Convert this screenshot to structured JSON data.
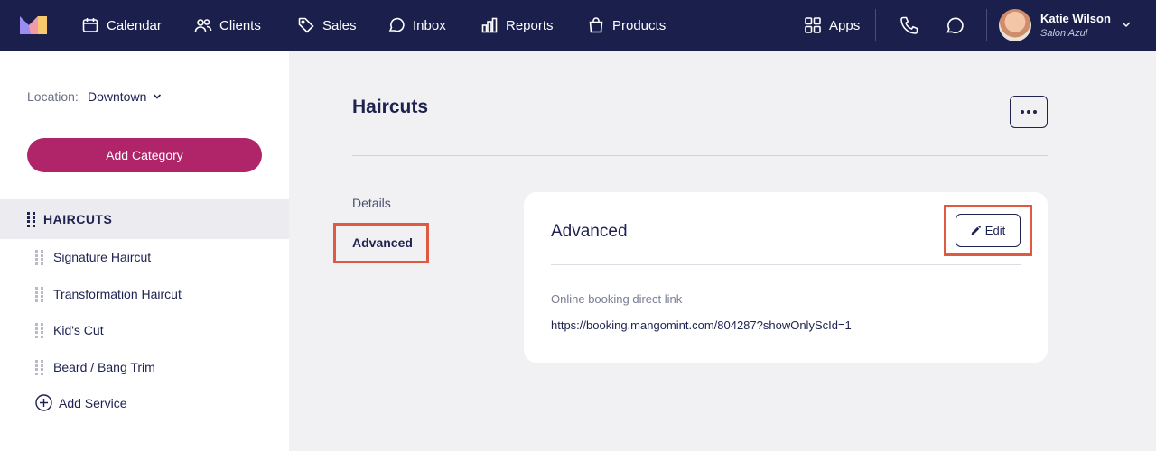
{
  "topbar": {
    "nav": [
      {
        "label": "Calendar",
        "icon": "calendar-icon"
      },
      {
        "label": "Clients",
        "icon": "users-icon"
      },
      {
        "label": "Sales",
        "icon": "tag-icon"
      },
      {
        "label": "Inbox",
        "icon": "chat-icon"
      },
      {
        "label": "Reports",
        "icon": "bar-chart-icon"
      },
      {
        "label": "Products",
        "icon": "shopping-bag-icon"
      }
    ],
    "apps_label": "Apps",
    "user": {
      "name": "Katie Wilson",
      "org": "Salon Azul"
    }
  },
  "sidebar": {
    "location_label": "Location:",
    "location_value": "Downtown",
    "add_category_label": "Add Category",
    "category": "HAIRCUTS",
    "services": [
      "Signature Haircut",
      "Transformation Haircut",
      "Kid's Cut",
      "Beard / Bang Trim"
    ],
    "add_service_label": "Add Service"
  },
  "main": {
    "title": "Haircuts",
    "tabs": [
      "Details",
      "Advanced"
    ],
    "card": {
      "title": "Advanced",
      "edit_label": "Edit",
      "link_label": "Online booking direct link",
      "link_value": "https://booking.mangomint.com/804287?showOnlyScId=1"
    }
  },
  "colors": {
    "topbar": "#1b1f4c",
    "accent": "#b0256a",
    "highlight": "#e05a43"
  }
}
